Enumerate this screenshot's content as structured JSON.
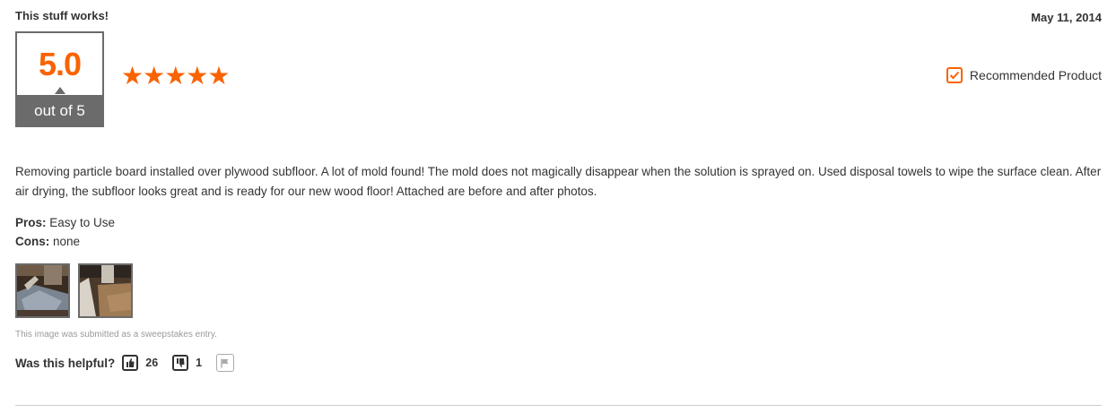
{
  "review": {
    "title": "This stuff works!",
    "date": "May 11, 2014",
    "score": "5.0",
    "score_caption": "out of 5",
    "stars": "★★★★★",
    "star_rating": 5,
    "recommended_label": "Recommended Product",
    "body": "Removing particle board installed over plywood subfloor. A lot of mold found! The mold does not magically disappear when the solution is sprayed on. Used disposal towels to wipe the surface clean. After air drying, the subfloor looks great and is ready for our new wood floor! Attached are before and after photos.",
    "pros_label": "Pros:",
    "pros_value": "Easy to Use",
    "cons_label": "Cons:",
    "cons_value": "none",
    "sweepstakes_note": "This image was submitted as a sweepstakes entry.",
    "helpful_label": "Was this helpful?",
    "helpful_yes": "26",
    "helpful_no": "1"
  },
  "colors": {
    "accent": "#f96302",
    "score_gray": "#6b6b6b",
    "text": "#333333"
  },
  "icons": {
    "recommended": "checkbox-check-icon",
    "vote_up": "thumbs-up-icon",
    "vote_down": "thumbs-down-icon",
    "report": "flag-icon"
  }
}
